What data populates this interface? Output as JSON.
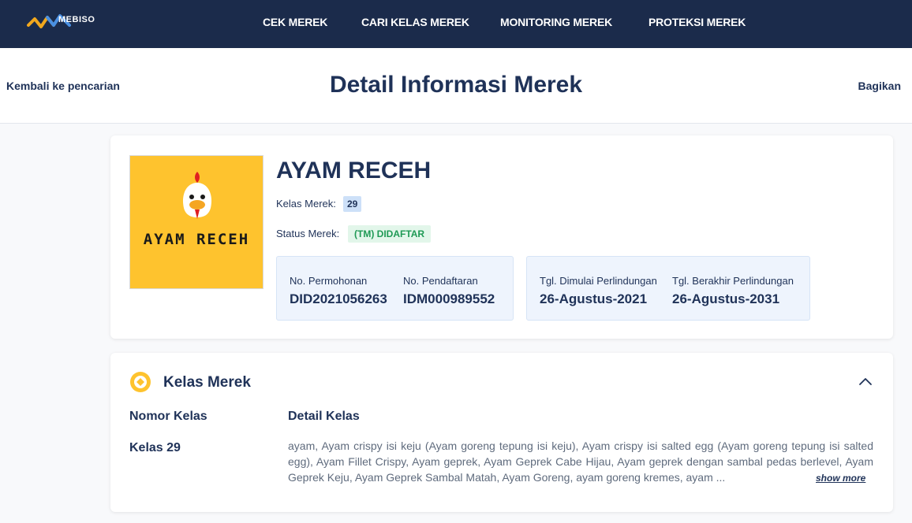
{
  "nav": {
    "logo_text": "MEBISO",
    "items": [
      {
        "label": "CEK MEREK"
      },
      {
        "label": "CARI KELAS MEREK"
      },
      {
        "label": "MONITORING MEREK"
      },
      {
        "label": "PROTEKSI MEREK"
      }
    ]
  },
  "subheader": {
    "back_label": "Kembali ke pencarian",
    "title": "Detail Informasi Merek",
    "share_label": "Bagikan"
  },
  "brand": {
    "image_text": "AYAM RECEH",
    "name": "AYAM RECEH",
    "class_label": "Kelas Merek:",
    "class_value": "29",
    "status_label": "Status Merek:",
    "status_value": "(TM) DIDAFTAR",
    "status_color": "#1f9a55",
    "application_no_label": "No. Permohonan",
    "application_no": "DID2021056263",
    "registration_no_label": "No. Pendaftaran",
    "registration_no": "IDM000989552",
    "protection_start_label": "Tgl. Dimulai Perlindungan",
    "protection_start": "26-Agustus-2021",
    "protection_end_label": "Tgl. Berakhir Perlindungan",
    "protection_end": "26-Agustus-2031"
  },
  "class_section": {
    "title": "Kelas Merek",
    "icon": "class-icon",
    "collapse_icon": "chevron-up-icon",
    "col_number": "Nomor Kelas",
    "col_detail": "Detail Kelas",
    "class_number": "Kelas 29",
    "class_detail": "ayam, Ayam crispy isi keju (Ayam goreng tepung isi keju), Ayam crispy isi salted egg (Ayam goreng tepung isi salted egg), Ayam Fillet Crispy, Ayam geprek, Ayam Geprek Cabe Hijau, Ayam geprek dengan sambal pedas berlevel, Ayam Geprek Keju, Ayam Geprek Sambal Matah, Ayam Goreng, ayam goreng kremes, ayam ...",
    "show_more": "show more"
  },
  "colors": {
    "navbar": "#1b2b4b",
    "primary_text": "#1f3258",
    "accent_yellow": "#fec32e",
    "badge_blue": "#cde0f8"
  }
}
